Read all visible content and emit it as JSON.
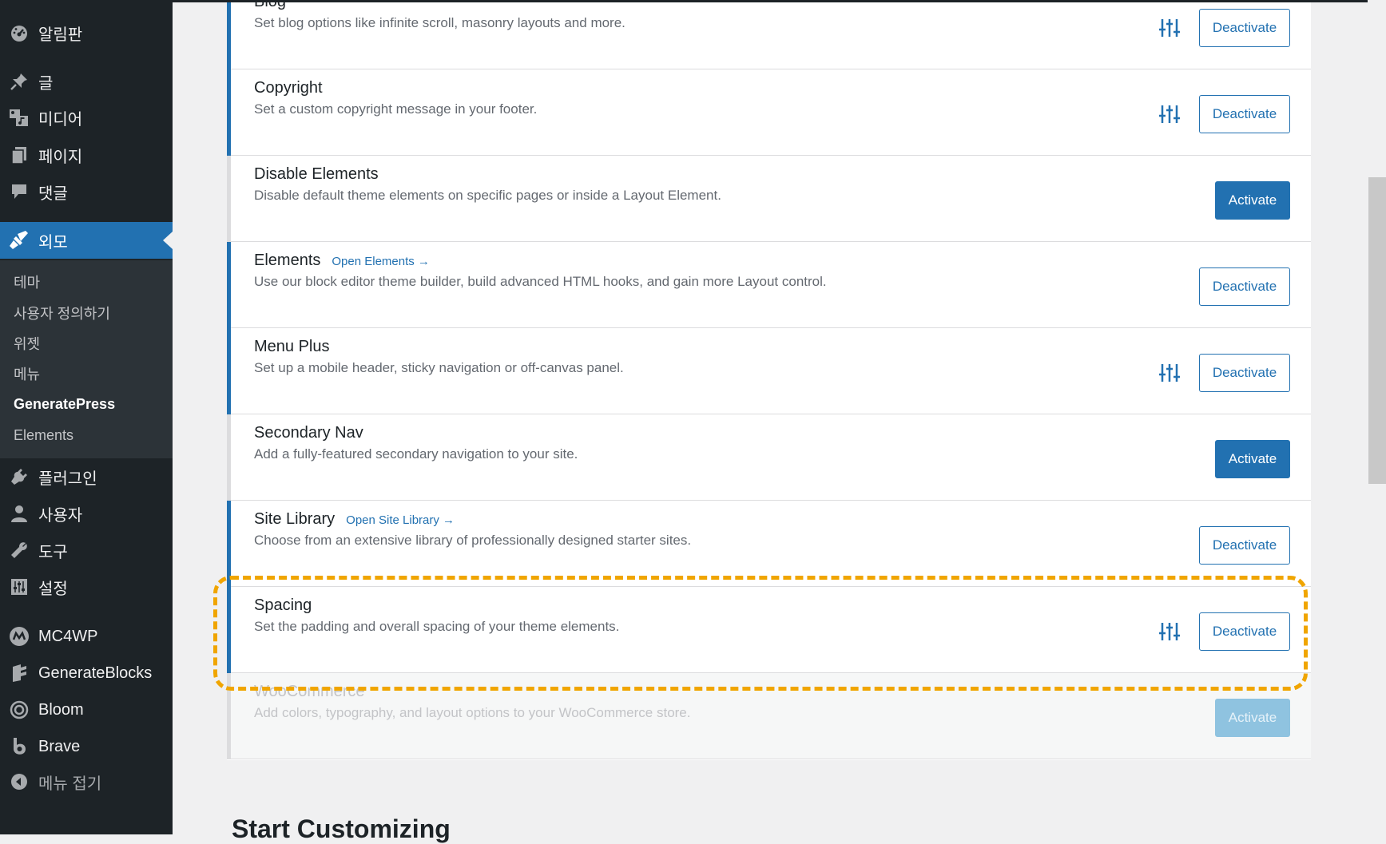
{
  "sidebar": {
    "items": [
      {
        "label": "알림판",
        "icon": "dashboard-icon"
      },
      {
        "label": "글",
        "icon": "pin-icon"
      },
      {
        "label": "미디어",
        "icon": "media-icon"
      },
      {
        "label": "페이지",
        "icon": "pages-icon"
      },
      {
        "label": "댓글",
        "icon": "comments-icon"
      },
      {
        "label": "외모",
        "icon": "brush-icon"
      },
      {
        "label": "플러그인",
        "icon": "plugin-icon"
      },
      {
        "label": "사용자",
        "icon": "user-icon"
      },
      {
        "label": "도구",
        "icon": "wrench-icon"
      },
      {
        "label": "설정",
        "icon": "settings-icon"
      },
      {
        "label": "MC4WP",
        "icon": "mc4wp-icon"
      },
      {
        "label": "GenerateBlocks",
        "icon": "generateblocks-icon"
      },
      {
        "label": "Bloom",
        "icon": "bloom-icon"
      },
      {
        "label": "Brave",
        "icon": "brave-icon"
      },
      {
        "label": "메뉴 접기",
        "icon": "collapse-icon"
      }
    ],
    "submenu": [
      "테마",
      "사용자 정의하기",
      "위젯",
      "메뉴",
      "GeneratePress",
      "Elements"
    ],
    "current_submenu": "GeneratePress"
  },
  "modules": [
    {
      "title": "Blog",
      "desc": "Set blog options like infinite scroll, masonry layouts and more.",
      "button": "Deactivate",
      "link": ""
    },
    {
      "title": "Copyright",
      "desc": "Set a custom copyright message in your footer.",
      "button": "Deactivate",
      "link": ""
    },
    {
      "title": "Disable Elements",
      "desc": "Disable default theme elements on specific pages or inside a Layout Element.",
      "button": "Activate",
      "link": ""
    },
    {
      "title": "Elements",
      "desc": "Use our block editor theme builder, build advanced HTML hooks, and gain more Layout control.",
      "button": "Deactivate",
      "link": "Open Elements →"
    },
    {
      "title": "Menu Plus",
      "desc": "Set up a mobile header, sticky navigation or off-canvas panel.",
      "button": "Deactivate",
      "link": ""
    },
    {
      "title": "Secondary Nav",
      "desc": "Add a fully-featured secondary navigation to your site.",
      "button": "Activate",
      "link": ""
    },
    {
      "title": "Site Library",
      "desc": "Choose from an extensive library of professionally designed starter sites.",
      "button": "Deactivate",
      "link": "Open Site Library →"
    },
    {
      "title": "Spacing",
      "desc": "Set the padding and overall spacing of your theme elements.",
      "button": "Deactivate",
      "link": ""
    },
    {
      "title": "WooCommerce",
      "desc": "Add colors, typography, and layout options to your WooCommerce store.",
      "button": "Activate",
      "link": ""
    }
  ],
  "section_heading": "Start Customizing",
  "colors": {
    "accent": "#2271b1",
    "sidebar": "#1d2327",
    "highlight": "#f0a500"
  }
}
